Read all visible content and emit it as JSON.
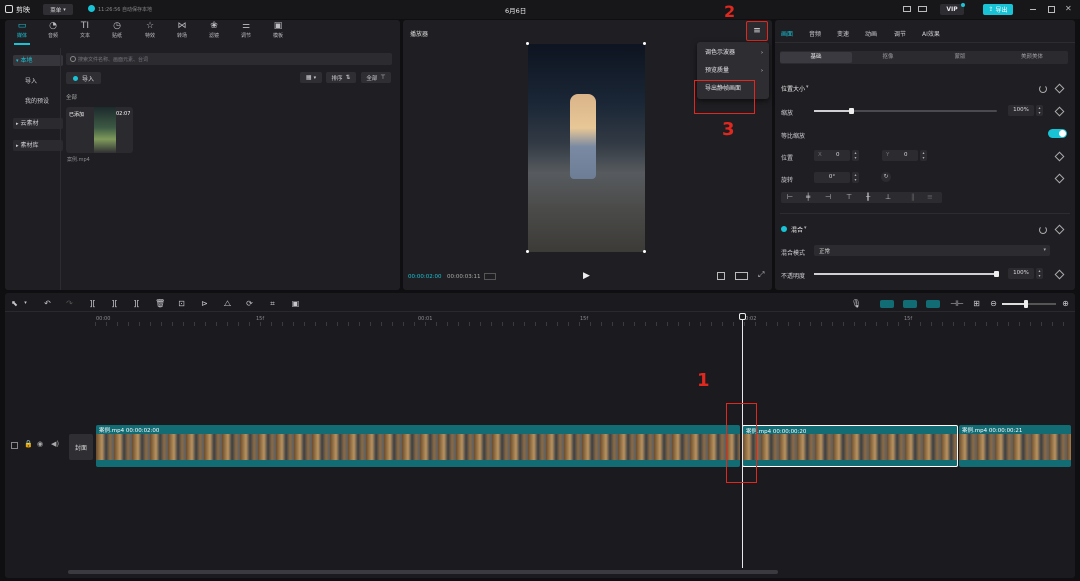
{
  "titlebar": {
    "app_name": "剪映",
    "menu_label": "菜单",
    "autosave": "11:26:56 自动保存本地",
    "project_title": "6月6日",
    "vip_label": "VIP",
    "export_label": "导出"
  },
  "toolbar": {
    "tabs": [
      {
        "label": "媒体",
        "icon": "media-icon",
        "glyph": "▭"
      },
      {
        "label": "音频",
        "icon": "audio-icon",
        "glyph": "◔"
      },
      {
        "label": "文本",
        "icon": "text-icon",
        "glyph": "TI"
      },
      {
        "label": "贴纸",
        "icon": "sticker-icon",
        "glyph": "◷"
      },
      {
        "label": "特效",
        "icon": "effects-icon",
        "glyph": "☆"
      },
      {
        "label": "转场",
        "icon": "transition-icon",
        "glyph": "⋈"
      },
      {
        "label": "滤镜",
        "icon": "filter-icon",
        "glyph": "❀"
      },
      {
        "label": "调节",
        "icon": "adjust-icon",
        "glyph": "⚌"
      },
      {
        "label": "模板",
        "icon": "template-icon",
        "glyph": "▣"
      }
    ]
  },
  "media": {
    "sidebar": [
      "本地",
      "导入",
      "我的预设",
      "云素材",
      "素材库"
    ],
    "search_placeholder": "搜索文件名称、画面元素、台词",
    "import_label": "导入",
    "sort_label": "排序",
    "filter_label": "全部",
    "section_label": "全部",
    "clip": {
      "badge": "已添加",
      "duration": "02:07",
      "filename": "案例.mp4"
    }
  },
  "player": {
    "title": "播放器",
    "current_time": "00:00:02:00",
    "total_time": "00:00:03:11",
    "menu": [
      "调色示波器",
      "预览质量",
      "导出静帧画面"
    ]
  },
  "annotations": {
    "one": "1",
    "two": "2",
    "three": "3"
  },
  "inspector": {
    "tabs": [
      "画面",
      "音频",
      "变速",
      "动画",
      "调节",
      "AI效果"
    ],
    "segments": [
      "基础",
      "抠像",
      "蒙版",
      "美颜美体"
    ],
    "position_size": "位置大小",
    "scale_label": "缩放",
    "scale_value": "100%",
    "uniform_label": "等比缩放",
    "position_label": "位置",
    "x_label": "X",
    "x_value": "0",
    "y_label": "Y",
    "y_value": "0",
    "rotate_label": "旋转",
    "rotate_value": "0°",
    "blend_label": "混合",
    "blend_mode_label": "混合模式",
    "blend_mode_value": "正常",
    "opacity_label": "不透明度",
    "opacity_value": "100%",
    "scale_fraction": 0.2,
    "opacity_fraction": 1.0
  },
  "timeline": {
    "ruler": [
      "00:00",
      "15f",
      "00:01",
      "15f",
      "00:02",
      "15f"
    ],
    "cover_label": "封面",
    "clips": [
      {
        "name": "案例.mp4",
        "duration": "00:00:02:00"
      },
      {
        "name": "案例.mp4",
        "duration": "00:00:00:20"
      },
      {
        "name": "案例.mp4",
        "duration": "00:00:00:21"
      }
    ]
  },
  "colors": {
    "accent": "#19c3d6",
    "highlight_red": "#e0281e",
    "panel": "#1f1f23",
    "clip_teal": "#116c74"
  }
}
